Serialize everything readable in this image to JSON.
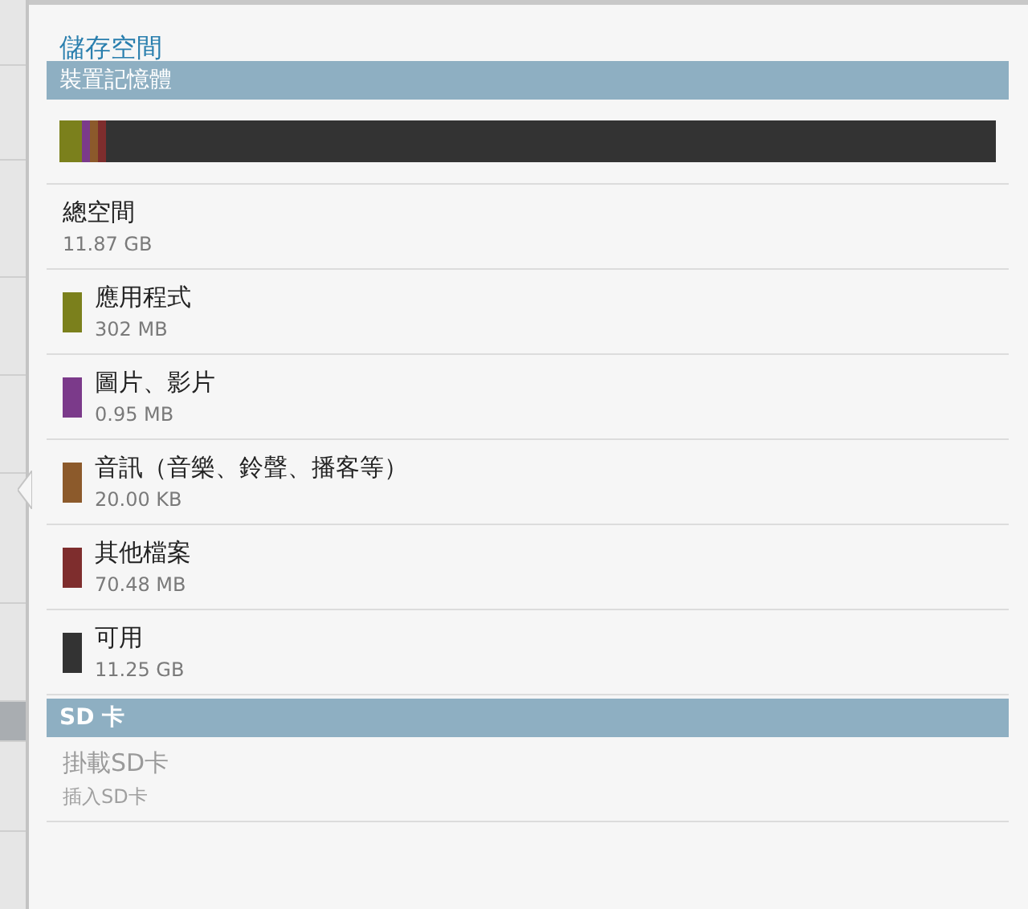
{
  "title": "儲存空間",
  "sections": [
    {
      "header": "裝置記憶體",
      "bar": [
        {
          "color": "#7b801c"
        },
        {
          "color": "#7b3a8a"
        },
        {
          "color": "#8c5a2b"
        },
        {
          "color": "#7e2d2d"
        },
        {
          "color": "#333333"
        }
      ],
      "items": [
        {
          "kind": "total",
          "label": "總空間",
          "value": "11.87 GB"
        },
        {
          "kind": "category",
          "label": "應用程式",
          "value": "302 MB",
          "color": "#7b801c"
        },
        {
          "kind": "category",
          "label": "圖片、影片",
          "value": "0.95 MB",
          "color": "#7b3a8a"
        },
        {
          "kind": "category",
          "label": "音訊（音樂、鈴聲、播客等）",
          "value": "20.00 KB",
          "color": "#8c5a2b"
        },
        {
          "kind": "category",
          "label": "其他檔案",
          "value": "70.48 MB",
          "color": "#7e2d2d"
        },
        {
          "kind": "category",
          "label": "可用",
          "value": "11.25 GB",
          "color": "#333333"
        }
      ]
    },
    {
      "header": "SD 卡",
      "items": [
        {
          "kind": "action",
          "label": "掛載SD卡",
          "value": "插入SD卡",
          "disabled": true
        }
      ]
    }
  ]
}
